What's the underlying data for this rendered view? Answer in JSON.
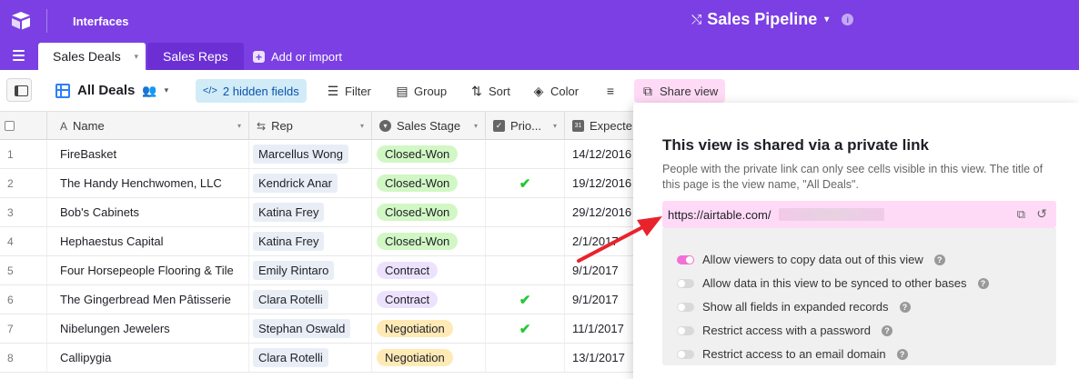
{
  "topbar": {
    "logo_icon": "airtable-logo-icon",
    "interfaces_label": "Interfaces",
    "base_glyph": "⤭",
    "base_title": "Sales Pipeline",
    "base_caret": "▾",
    "info": "i"
  },
  "tabs": {
    "active": "Sales Deals",
    "active_caret": "▾",
    "other": "Sales Reps",
    "add_plus": "+",
    "add_import": "Add or import"
  },
  "toolbar": {
    "view_name": "All Deals",
    "people_glyph": "👥",
    "view_caret": "▾",
    "hidden_icon": "</>",
    "hidden_fields": "2 hidden fields",
    "filter_icon": "☰",
    "filter": "Filter",
    "group_icon": "▤",
    "group": "Group",
    "sort_icon": "⇅",
    "sort": "Sort",
    "color_icon": "◈",
    "color": "Color",
    "rowheight_icon": "≡",
    "share_icon": "⧉",
    "share_view": "Share view"
  },
  "columns": {
    "name": "Name",
    "name_icon": "A",
    "rep": "Rep",
    "rep_icon": "⇆",
    "stage": "Sales Stage",
    "stage_icon": "▾",
    "priority": "Prio...",
    "priority_icon": "✓",
    "expected": "Expecte",
    "expected_icon": "31",
    "dropdown": "▾"
  },
  "rows": [
    {
      "num": "1",
      "name": "FireBasket",
      "rep": "Marcellus Wong",
      "stage": "Closed-Won",
      "priority": "",
      "date": "14/12/2016"
    },
    {
      "num": "2",
      "name": "The Handy Henchwomen, LLC",
      "rep": "Kendrick Anar",
      "stage": "Closed-Won",
      "priority": "✔",
      "date": "19/12/2016"
    },
    {
      "num": "3",
      "name": "Bob's Cabinets",
      "rep": "Katina Frey",
      "stage": "Closed-Won",
      "priority": "",
      "date": "29/12/2016"
    },
    {
      "num": "4",
      "name": "Hephaestus Capital",
      "rep": "Katina Frey",
      "stage": "Closed-Won",
      "priority": "",
      "date": "2/1/2017"
    },
    {
      "num": "5",
      "name": "Four Horsepeople Flooring & Tile",
      "rep": "Emily Rintaro",
      "stage": "Contract",
      "priority": "",
      "date": "9/1/2017"
    },
    {
      "num": "6",
      "name": "The Gingerbread Men Pâtisserie",
      "rep": "Clara Rotelli",
      "stage": "Contract",
      "priority": "✔",
      "date": "9/1/2017"
    },
    {
      "num": "7",
      "name": "Nibelungen Jewelers",
      "rep": "Stephan Oswald",
      "stage": "Negotiation",
      "priority": "✔",
      "date": "11/1/2017"
    },
    {
      "num": "8",
      "name": "Callipygia",
      "rep": "Clara Rotelli",
      "stage": "Negotiation",
      "priority": "",
      "date": "13/1/2017"
    }
  ],
  "stage_colors": {
    "Closed-Won": "#d1f7c4",
    "Contract": "#ede2fe",
    "Negotiation": "#ffeab6"
  },
  "share_panel": {
    "title": "This view is shared via a private link",
    "description": "People with the private link can only see cells visible in this view. The title of this page is the view name, \"All Deals\".",
    "link": "https://airtable.com/",
    "open_icon": "⧉",
    "reset_icon": "↺",
    "help": "?",
    "options": [
      {
        "label": "Allow viewers to copy data out of this view",
        "on": true
      },
      {
        "label": "Allow data in this view to be synced to other bases",
        "on": false
      },
      {
        "label": "Show all fields in expanded records",
        "on": false
      },
      {
        "label": "Restrict access with a password",
        "on": false
      },
      {
        "label": "Restrict access to an email domain",
        "on": false
      }
    ]
  },
  "colors": {
    "brand": "#7b3fe4",
    "share_pink": "#ffdaf6",
    "toggle_on": "#f36fd6",
    "check_green": "#20c933",
    "arrow_red": "#e8232c"
  }
}
